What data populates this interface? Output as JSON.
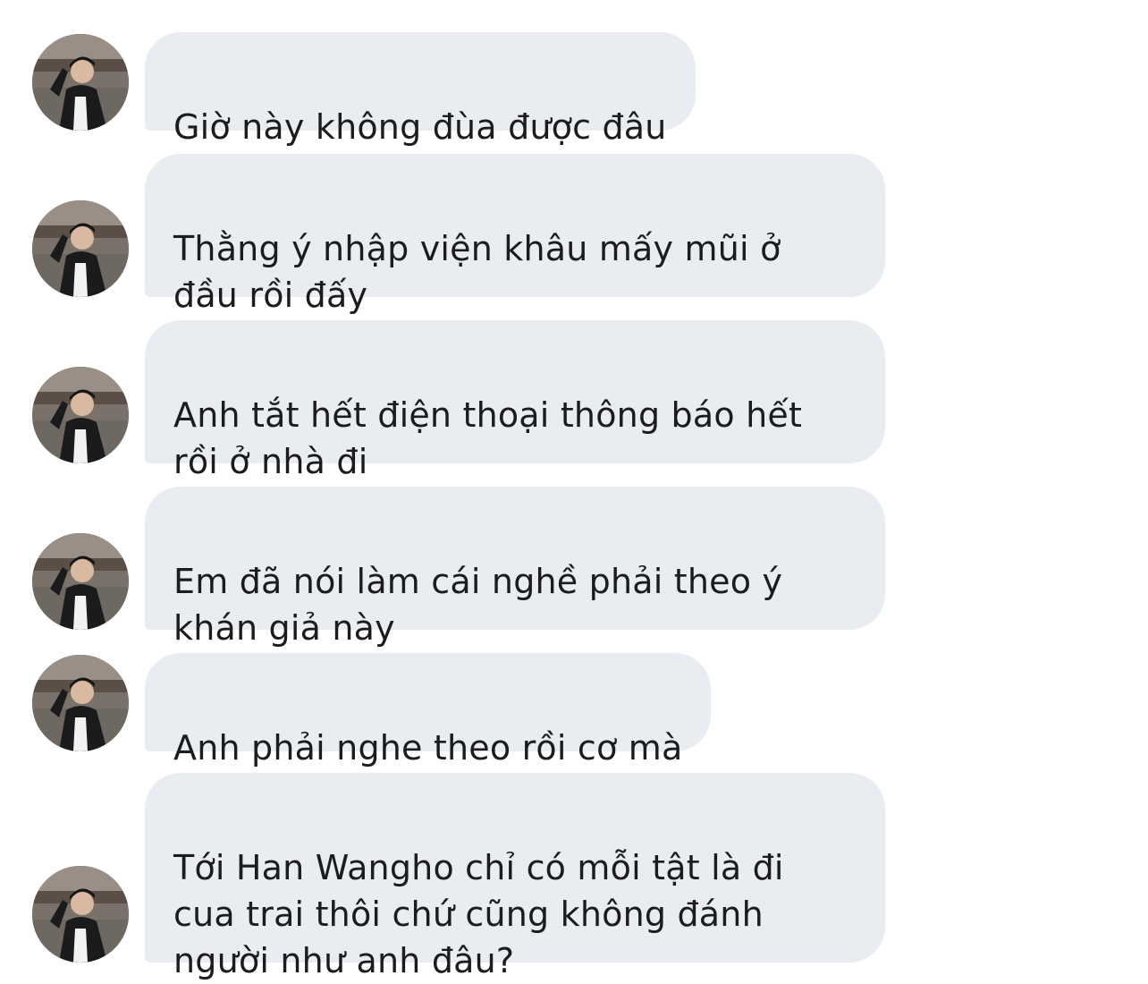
{
  "conversation": {
    "messages": [
      {
        "text": "Giờ này không đùa được đâu",
        "avatar_icon": "user-avatar-icon"
      },
      {
        "text": "Thằng ý nhập viện khâu mấy mũi ở\nđầu rồi đấy",
        "avatar_icon": "user-avatar-icon"
      },
      {
        "text": "Anh tắt hết điện thoại thông báo hết\nrồi ở nhà đi",
        "avatar_icon": "user-avatar-icon"
      },
      {
        "text": "Em đã nói làm cái nghề phải theo ý\nkhán giả này",
        "avatar_icon": "user-avatar-icon"
      },
      {
        "text": "Anh phải nghe theo rồi cơ mà",
        "avatar_icon": "user-avatar-icon"
      },
      {
        "text": "Tới Han Wangho chỉ có mỗi tật là đi\ncua trai thôi chứ cũng không đánh\nngười như anh đâu?",
        "avatar_icon": "user-avatar-icon"
      }
    ],
    "colors": {
      "bubble_bg": "#e9ecf0",
      "text": "#1c1c1e",
      "background": "#ffffff"
    }
  }
}
